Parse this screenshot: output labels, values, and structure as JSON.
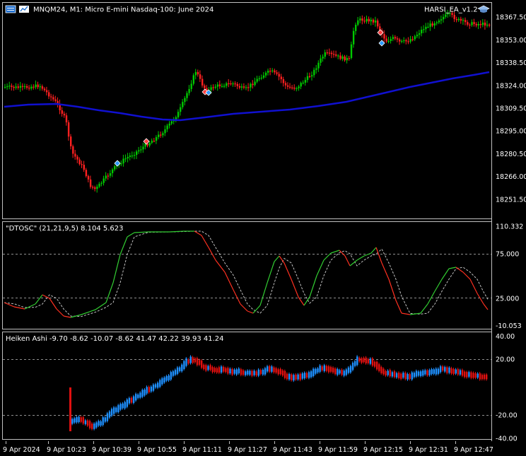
{
  "main_pane": {
    "symbol_title": "MNQM24, M1:  Micro E-mini Nasdaq-100: June 2024",
    "expert_name": "HARSI_EA_v1.2",
    "price_labels": [
      "18367.50",
      "18353.00",
      "18338.50",
      "18324.00",
      "18309.50",
      "18295.00",
      "18280.50",
      "18266.00",
      "18251.50"
    ]
  },
  "oscillator_pane": {
    "title": "\"DTOSC\" (21,21,9,5) 8.104 5.623",
    "labels": [
      "110.332",
      "75.000",
      "25.000",
      "-10.053"
    ]
  },
  "heiken_pane": {
    "title": "Heiken Ashi -9.70 -8.62 -10.07 -8.62 41.47 42.22 39.93 41.24",
    "labels": [
      "40.00",
      "20.00",
      "-20.00",
      "-40.00"
    ]
  },
  "time_axis": {
    "labels": [
      "9 Apr 2024",
      "9 Apr 10:23",
      "9 Apr 10:39",
      "9 Apr 10:55",
      "9 Apr 11:11",
      "9 Apr 11:27",
      "9 Apr 11:43",
      "9 Apr 11:59",
      "9 Apr 12:15",
      "9 Apr 12:31",
      "9 Apr 12:47"
    ]
  },
  "colors": {
    "background": "#000000",
    "bull_candle": "#00C800",
    "bear_candle": "#FF2020",
    "moving_average": "#1010D0",
    "osc_main_up": "#32CD32",
    "osc_main_down": "#FF3020",
    "ha_bull": "#1E90FF",
    "ha_bear": "#E01010",
    "grid_dashed": "#C0C0C0",
    "pane_border": "#C0C0C0"
  }
}
